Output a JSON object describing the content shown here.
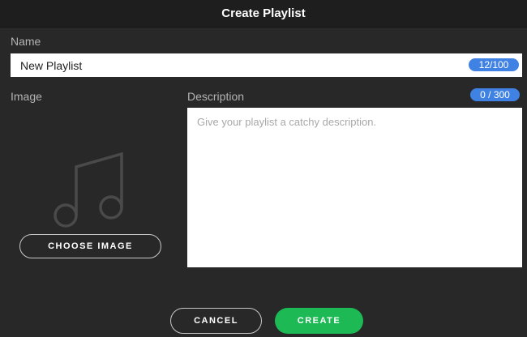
{
  "dialog": {
    "title": "Create Playlist"
  },
  "name": {
    "label": "Name",
    "value": "New Playlist",
    "counter": "12/100"
  },
  "image": {
    "label": "Image",
    "placeholder_icon": "music-note-icon",
    "choose_label": "CHOOSE IMAGE"
  },
  "description": {
    "label": "Description",
    "placeholder": "Give your playlist a catchy description.",
    "counter": "0 / 300"
  },
  "actions": {
    "cancel_label": "CANCEL",
    "create_label": "CREATE"
  },
  "colors": {
    "background": "#282828",
    "titlebar": "#1e1e1e",
    "counter_badge": "#3f82e4",
    "create_button": "#1db954"
  }
}
